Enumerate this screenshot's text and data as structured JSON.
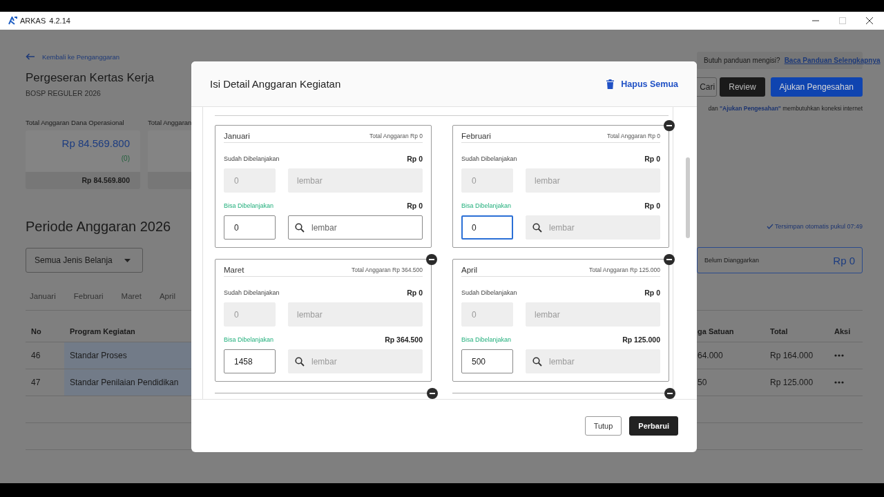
{
  "window": {
    "app_name": "ARKAS",
    "version": "4.2.14"
  },
  "page": {
    "back_link": "Kembali ke Penganggaran",
    "title": "Pergeseran Kertas Kerja",
    "subtitle": "BOSP REGULER 2026",
    "summary": [
      {
        "label": "Total Anggaran Dana Operasional",
        "amount": "Rp 84.569.800",
        "change": "(0)",
        "footer": "Rp 84.569.800"
      },
      {
        "label": "Total Anggaran"
      }
    ],
    "guide": {
      "question": "Butuh panduan mengisi?",
      "link": "Baca Panduan Selengkapnya"
    },
    "buttons": [
      {
        "label": "Cari",
        "kind": "outline"
      },
      {
        "label": "Review",
        "kind": "dark"
      },
      {
        "label": "Ajukan Pengesahan",
        "kind": "primary"
      }
    ],
    "note": "dan **\"Ajukan Pengesahan\"** membutuhkan koneksi internet",
    "period_title": "Periode Anggaran 2026",
    "autosave": "Tersimpan otomatis pukul 07:49",
    "filter": {
      "value": "Semua Jenis Belanja"
    },
    "unbudgeted": {
      "label": "Belum Dianggarkan",
      "amount": "Rp 0"
    },
    "month_tabs": [
      {
        "label": "Januari",
        "selected": false
      },
      {
        "label": "Februari",
        "selected": false
      },
      {
        "label": "Maret",
        "selected": false
      },
      {
        "label": "April",
        "selected": false
      }
    ],
    "table": {
      "columns": [
        "No",
        "Program Kegiatan",
        "ga Satuan",
        "Total",
        "Aksi"
      ],
      "rows": [
        {
          "no": "46",
          "program": "Standar Proses",
          "unit_price": "64.000",
          "total": "Rp 164.000"
        },
        {
          "no": "47",
          "program": "Standar Penilaian Pendidikan",
          "unit_price": "50",
          "total": "Rp 125.000"
        }
      ]
    }
  },
  "modal": {
    "title": "Isi Detail Anggaran Kegiatan",
    "clear_all": "Hapus Semua",
    "months": [
      {
        "name": "Januari",
        "total": "Total Anggaran Rp 0",
        "spent_label": "Sudah Dibelanjakan",
        "spent_amount": "Rp 0",
        "spent_qty": "0",
        "spent_unit": "lembar",
        "avail_label": "Bisa Dibelanjakan",
        "avail_amount": "Rp 0",
        "qty": "0",
        "unit": "lembar",
        "unit_disabled": false,
        "focused": false,
        "removable": false
      },
      {
        "name": "Februari",
        "total": "Total Anggaran Rp 0",
        "spent_label": "Sudah Dibelanjakan",
        "spent_amount": "Rp 0",
        "spent_qty": "0",
        "spent_unit": "lembar",
        "avail_label": "Bisa Dibelanjakan",
        "avail_amount": "Rp 0",
        "qty": "0",
        "unit": "lembar",
        "unit_disabled": true,
        "focused": true,
        "removable": true
      },
      {
        "name": "Maret",
        "total": "Total Anggaran Rp 364.500",
        "spent_label": "Sudah Dibelanjakan",
        "spent_amount": "Rp 0",
        "spent_qty": "0",
        "spent_unit": "lembar",
        "avail_label": "Bisa Dibelanjakan",
        "avail_amount": "Rp 364.500",
        "qty": "1458",
        "unit": "lembar",
        "unit_disabled": true,
        "focused": false,
        "removable": true
      },
      {
        "name": "April",
        "total": "Total Anggaran Rp 125.000",
        "spent_label": "Sudah Dibelanjakan",
        "spent_amount": "Rp 0",
        "spent_qty": "0",
        "spent_unit": "lembar",
        "avail_label": "Bisa Dibelanjakan",
        "avail_amount": "Rp 125.000",
        "qty": "500",
        "unit": "lembar",
        "unit_disabled": true,
        "focused": false,
        "removable": true
      }
    ],
    "buttons": [
      {
        "label": "Tutup",
        "kind": "secondary"
      },
      {
        "label": "Perbarui",
        "kind": "primary"
      }
    ]
  }
}
